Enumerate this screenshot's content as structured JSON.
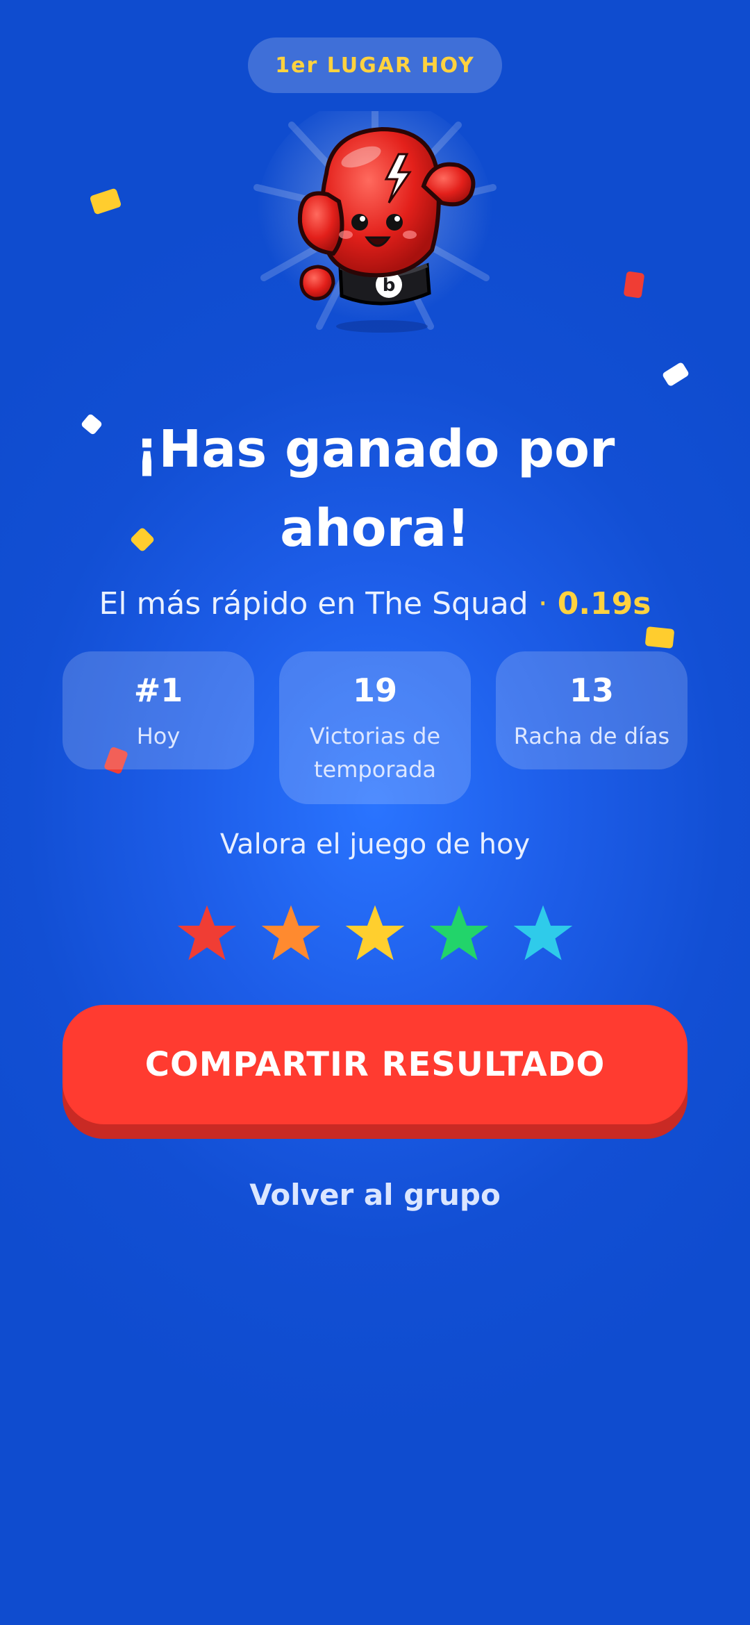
{
  "badge": {
    "label": "1er LUGAR HOY"
  },
  "mascot": {
    "name": "boxing-glove-mascot",
    "band_letter": "b"
  },
  "title": "¡Has ganado por ahora!",
  "subtitle": {
    "text": "El más rápido en The Squad",
    "separator": "·",
    "time": "0.19s"
  },
  "stats": [
    {
      "value": "#1",
      "label": "Hoy"
    },
    {
      "value": "19",
      "label": "Victorias de temporada"
    },
    {
      "value": "13",
      "label": "Racha de días"
    }
  ],
  "rating": {
    "label": "Valora el juego de hoy",
    "stars": [
      {
        "color": "#f03d34"
      },
      {
        "color": "#ff8a2f"
      },
      {
        "color": "#ffcf2e"
      },
      {
        "color": "#22d46a"
      },
      {
        "color": "#2fcbea"
      }
    ]
  },
  "actions": {
    "share_label": "COMPARTIR RESULTADO",
    "back_label": "Volver al grupo"
  },
  "colors": {
    "background": "#124fd4",
    "accent_yellow": "#ffd23f",
    "share_button": "#ff3b30"
  }
}
